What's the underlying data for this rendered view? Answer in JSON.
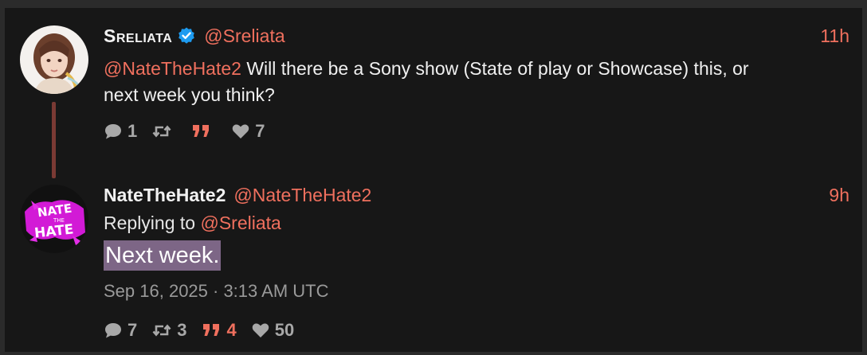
{
  "tweets": [
    {
      "display_name": "Sreliata",
      "handle": "@Sreliata",
      "time": "11h",
      "verified": true,
      "mention": "@NateTheHate2",
      "text_line1": " Will there be a Sony show (State of play or Showcase) this, or",
      "text_line2": "next week you think?",
      "stats": {
        "replies": "1",
        "retweets": "",
        "quotes": "",
        "likes": "7"
      }
    },
    {
      "display_name": "NateTheHate2",
      "handle": "@NateTheHate2",
      "time": "9h",
      "replying_to_label": "Replying to ",
      "replying_to_handle": "@Sreliata",
      "text": "Next week.",
      "date": "Sep 16, 2025 · 3:13 AM UTC",
      "stats": {
        "replies": "7",
        "retweets": "3",
        "quotes": "4",
        "likes": "50"
      }
    }
  ],
  "colors": {
    "accent": "#f0705e",
    "background": "#171717",
    "highlight": "#7d6686",
    "thread_line": "#7a3a34"
  },
  "icons": {
    "reply": "speech-bubble-icon",
    "retweet": "retweet-icon",
    "quote": "quote-icon",
    "like": "heart-icon",
    "verified": "verified-badge-icon"
  }
}
